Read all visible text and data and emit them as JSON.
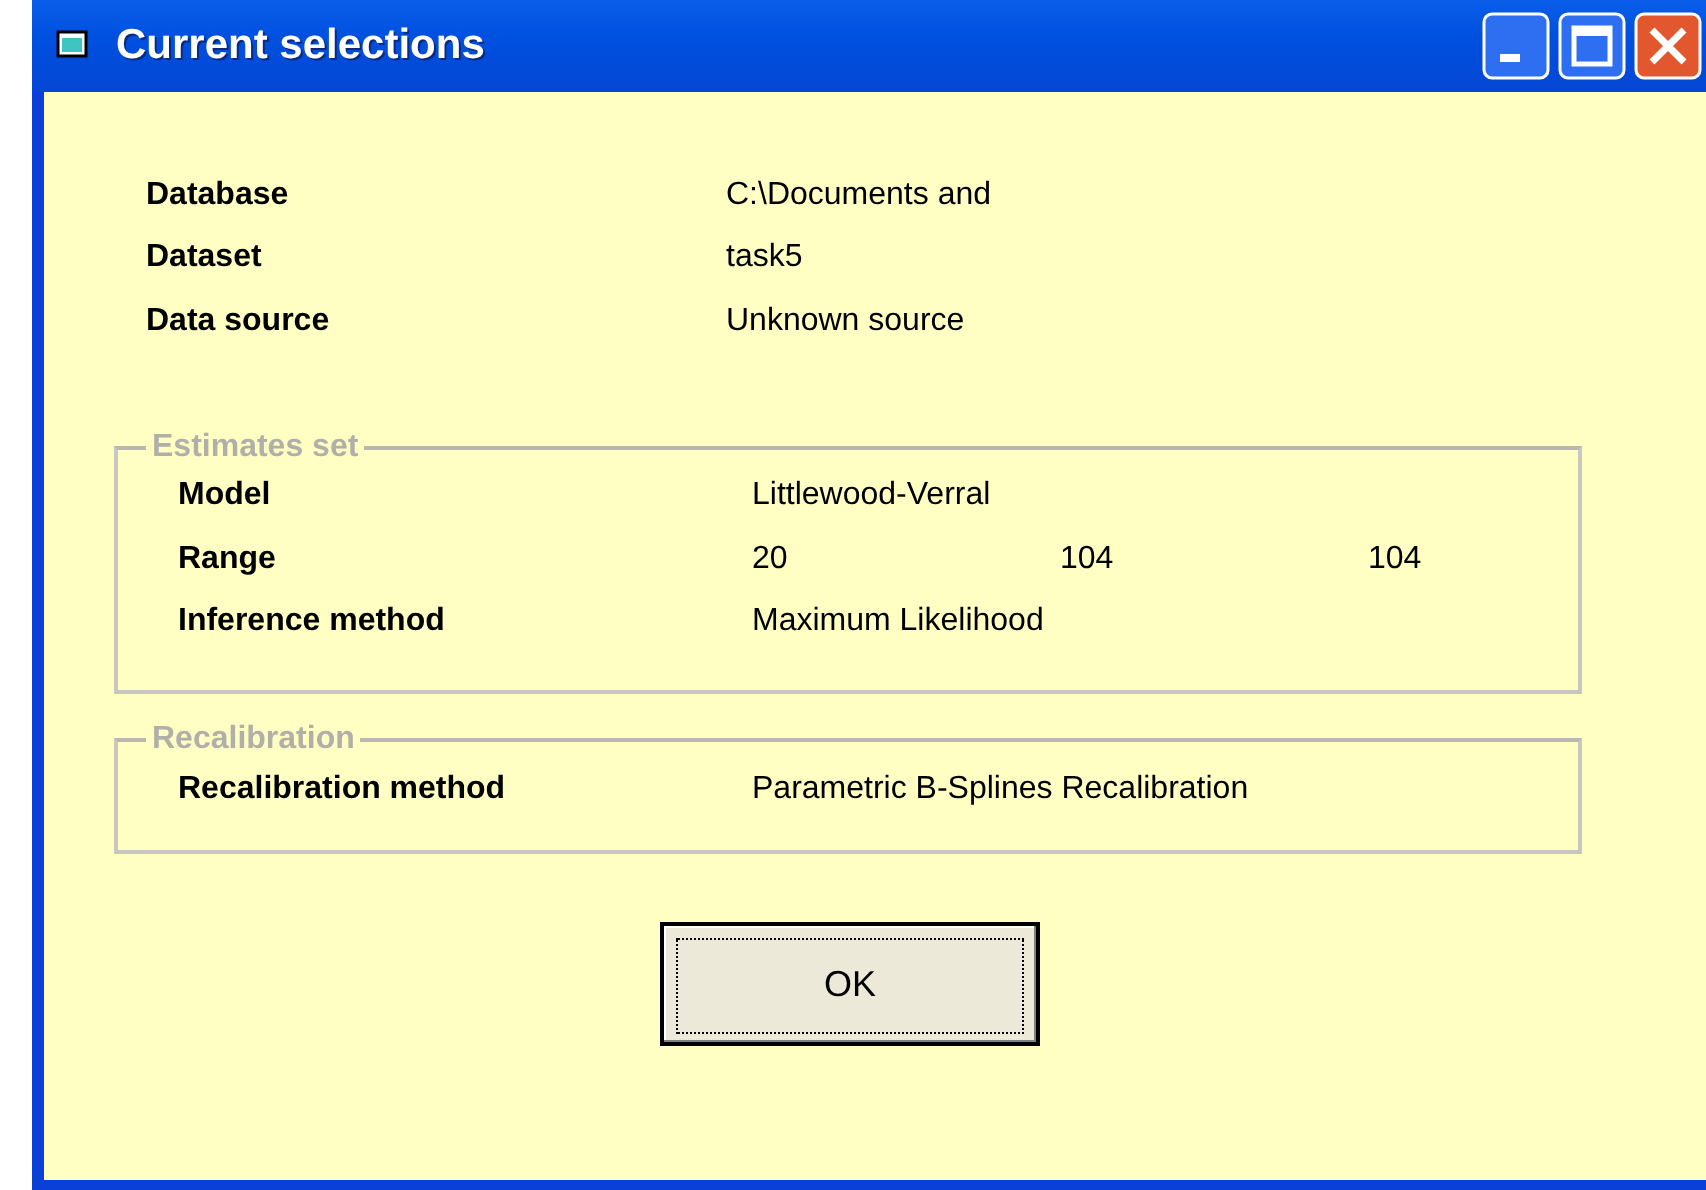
{
  "window": {
    "title": "Current selections"
  },
  "fields": [
    {
      "label": "Database",
      "value": "C:\\Documents and"
    },
    {
      "label": "Dataset",
      "value": "task5"
    },
    {
      "label": "Data source",
      "value": "Unknown source"
    }
  ],
  "groups": [
    {
      "title": "Estimates set",
      "rows": [
        {
          "label": "Model",
          "values": [
            "Littlewood-Verral"
          ]
        },
        {
          "label": "Range",
          "values": [
            "20",
            "104",
            "104"
          ]
        },
        {
          "label": "Inference method",
          "values": [
            "Maximum Likelihood"
          ]
        }
      ]
    },
    {
      "title": "Recalibration",
      "rows": [
        {
          "label": "Recalibration method",
          "values": [
            "Parametric B-Splines Recalibration"
          ]
        }
      ]
    }
  ],
  "buttons": [
    "OK"
  ]
}
